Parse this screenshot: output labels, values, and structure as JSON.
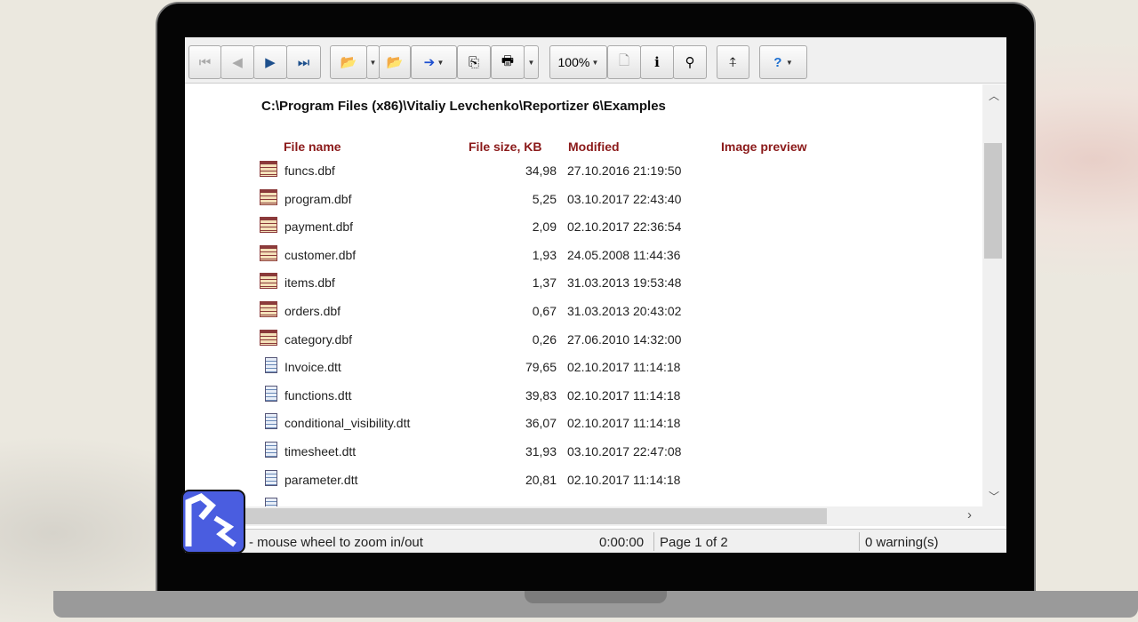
{
  "toolbar": {
    "zoom_label": "100%",
    "buttons": [
      "first-page",
      "previous-page",
      "next-page",
      "last-page",
      "open",
      "open-dropdown",
      "close",
      "export",
      "export-dropdown",
      "copy",
      "print",
      "print-dropdown",
      "zoom",
      "page-setup",
      "info",
      "find",
      "fit-page",
      "help",
      "help-dropdown"
    ]
  },
  "path": "C:\\Program Files (x86)\\Vitaliy Levchenko\\Reportizer 6\\Examples",
  "headers": {
    "name": "File name",
    "size": "File size, KB",
    "modified": "Modified",
    "preview": "Image preview"
  },
  "files": [
    {
      "name": "funcs.dbf",
      "size": "34,98",
      "modified": "27.10.2016 21:19:50",
      "type": "dbf"
    },
    {
      "name": "program.dbf",
      "size": "5,25",
      "modified": "03.10.2017 22:43:40",
      "type": "dbf"
    },
    {
      "name": "payment.dbf",
      "size": "2,09",
      "modified": "02.10.2017 22:36:54",
      "type": "dbf"
    },
    {
      "name": "customer.dbf",
      "size": "1,93",
      "modified": "24.05.2008 11:44:36",
      "type": "dbf"
    },
    {
      "name": "items.dbf",
      "size": "1,37",
      "modified": "31.03.2013 19:53:48",
      "type": "dbf"
    },
    {
      "name": "orders.dbf",
      "size": "0,67",
      "modified": "31.03.2013 20:43:02",
      "type": "dbf"
    },
    {
      "name": "category.dbf",
      "size": "0,26",
      "modified": "27.06.2010 14:32:00",
      "type": "dbf"
    },
    {
      "name": "Invoice.dtt",
      "size": "79,65",
      "modified": "02.10.2017 11:14:18",
      "type": "dtt"
    },
    {
      "name": "functions.dtt",
      "size": "39,83",
      "modified": "02.10.2017 11:14:18",
      "type": "dtt"
    },
    {
      "name": "conditional_visibility.dtt",
      "size": "36,07",
      "modified": "02.10.2017 11:14:18",
      "type": "dtt"
    },
    {
      "name": "timesheet.dtt",
      "size": "31,93",
      "modified": "03.10.2017 22:47:08",
      "type": "dtt"
    },
    {
      "name": "parameter.dtt",
      "size": "20,81",
      "modified": "02.10.2017 11:14:18",
      "type": "dtt"
    }
  ],
  "status": {
    "hint": "- mouse wheel to zoom in/out",
    "time": "0:00:00",
    "page": "Page 1 of 2",
    "warnings": "0 warning(s)"
  }
}
